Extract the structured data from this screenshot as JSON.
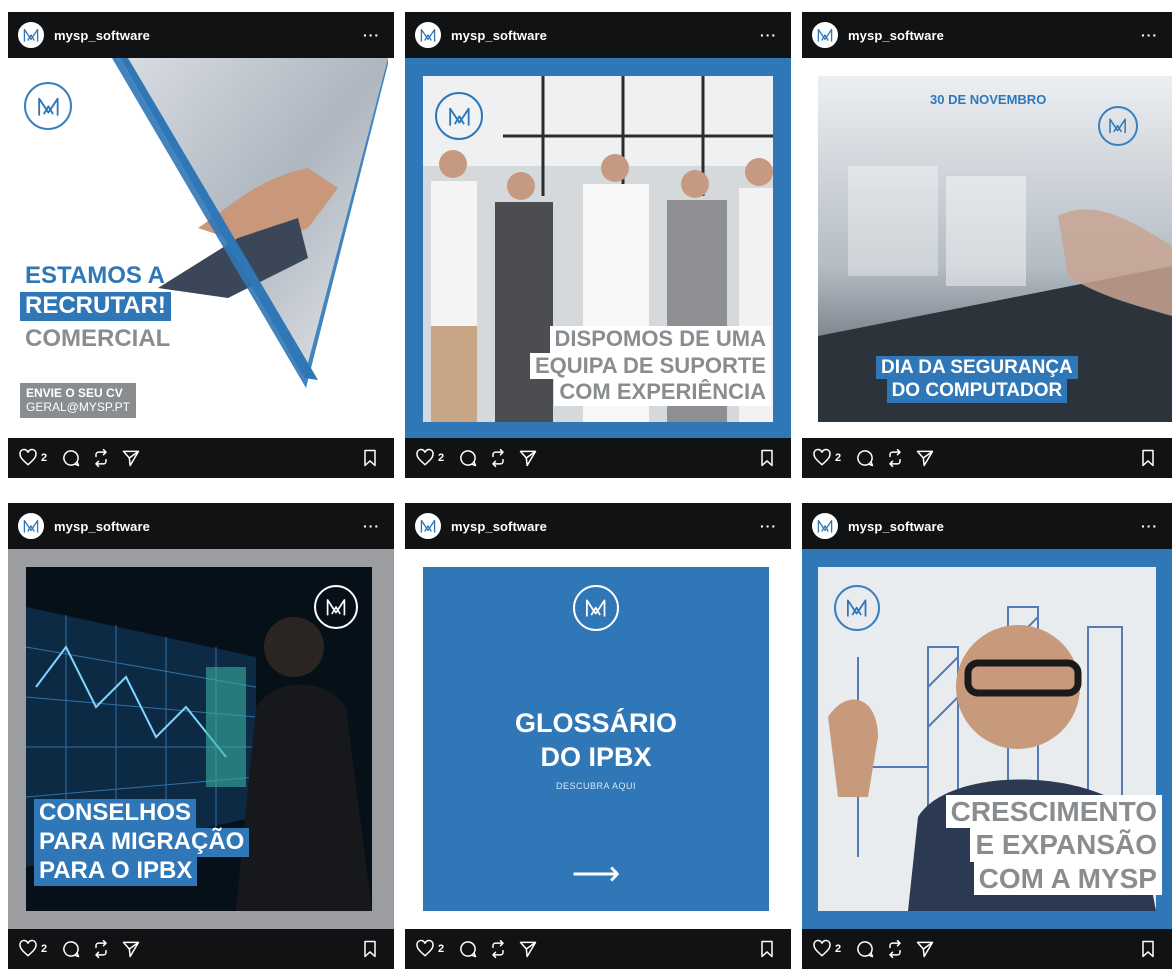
{
  "username": "mysp_software",
  "more_label": "···",
  "like_count": "2",
  "colors": {
    "brand_blue": "#2f77b7",
    "dark": "#111214",
    "grey_frame": "#9b9da0"
  },
  "posts": [
    {
      "headline1": "ESTAMOS A",
      "headline2": "RECRUTAR!",
      "headline3": "COMERCIAL",
      "cta1": "ENVIE O SEU CV",
      "cta2": "GERAL@MYSP.PT"
    },
    {
      "line1": "DISPOMOS DE UMA",
      "line2": "EQUIPA DE SUPORTE",
      "line3": "COM EXPERIÊNCIA"
    },
    {
      "date": "30 DE NOVEMBRO",
      "line1": "DIA DA SEGURANÇA",
      "line2": "DO COMPUTADOR"
    },
    {
      "line1": "CONSELHOS",
      "line2": "PARA MIGRAÇÃO",
      "line3": "PARA O IPBX"
    },
    {
      "title1": "GLOSSÁRIO",
      "title2": "DO IPBX",
      "subtitle": "DESCUBRA AQUI",
      "arrow": "⟶"
    },
    {
      "line1": "CRESCIMENTO",
      "line2": "E EXPANSÃO",
      "line3": "COM A MYSP"
    }
  ]
}
